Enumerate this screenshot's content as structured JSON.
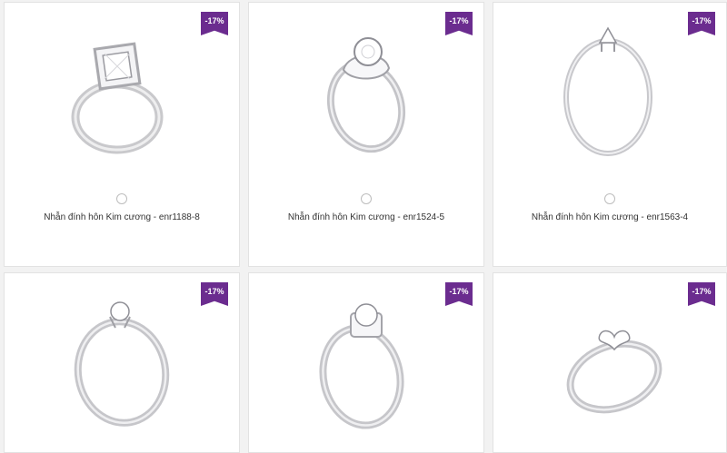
{
  "colors": {
    "badge": "#6b2c8f"
  },
  "products": [
    {
      "discount": "-17%",
      "name": "Nhẫn đính hôn Kim cương - enr1188-8",
      "style": "princess-halo"
    },
    {
      "discount": "-17%",
      "name": "Nhẫn đính hôn Kim cương - enr1524-5",
      "style": "twisted-halo"
    },
    {
      "discount": "-17%",
      "name": "Nhẫn đính hôn Kim cương - enr1563-4",
      "style": "solitaire-side"
    },
    {
      "discount": "-17%",
      "name": "",
      "style": "solitaire"
    },
    {
      "discount": "-17%",
      "name": "",
      "style": "halo-solitaire"
    },
    {
      "discount": "-17%",
      "name": "",
      "style": "heart-pave"
    }
  ]
}
